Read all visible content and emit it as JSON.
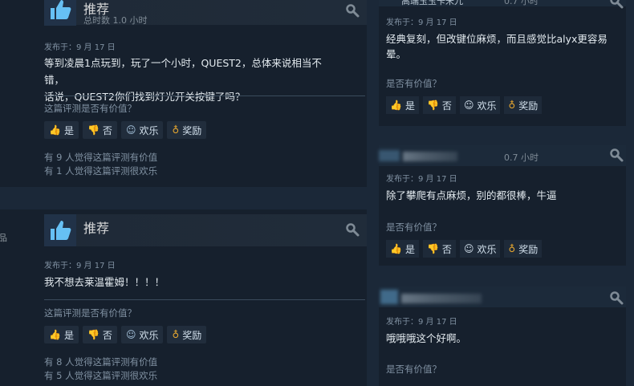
{
  "left_reviews": [
    {
      "recommendation": "推荐",
      "hours": "总时数 1.0 小时",
      "posted": "发布于：9 月 17 日",
      "text_lines": [
        "等到凌晨1点玩到，玩了一个小时，QUEST2，总体来说相当不错，",
        "话说，QUEST2你们找到灯光开关按键了吗？"
      ],
      "helpful_question": "这篇评测是否有价值？",
      "buttons": {
        "yes": "是",
        "no": "否",
        "funny": "欢乐",
        "award": "奖励"
      },
      "votes": [
        "有 9 人觉得这篇评测有价值",
        "有 1 人觉得这篇评测很欢乐"
      ]
    },
    {
      "recommendation": "推荐",
      "posted": "发布于：9 月 17 日",
      "text_lines": [
        "我不想去莱温霍姆！！！！"
      ],
      "helpful_question": "这篇评测是否有价值？",
      "buttons": {
        "yes": "是",
        "no": "否",
        "funny": "欢乐",
        "award": "奖励"
      },
      "votes": [
        "有 8 人觉得这篇评测有价值",
        "有 5 人觉得这篇评测很欢乐"
      ]
    }
  ],
  "right_reviews": [
    {
      "header_fragment": "高端玉玉卡米九",
      "hours": "0.7 小时",
      "posted": "发布于：9 月 17 日",
      "text_lines": [
        "经典复刻，但改键位麻烦，而且感觉比alyx更容易",
        "晕。"
      ],
      "helpful_question": "是否有价值？",
      "buttons": {
        "yes": "是",
        "no": "否",
        "funny": "欢乐",
        "award": "奖励"
      }
    },
    {
      "hours": "0.7 小时",
      "posted": "发布于：9 月 17 日",
      "text_lines": [
        "除了攀爬有点麻烦，别的都很棒，牛逼"
      ],
      "helpful_question": "是否有价值？",
      "buttons": {
        "yes": "是",
        "no": "否",
        "funny": "欢乐",
        "award": "奖励"
      }
    },
    {
      "posted": "发布于：9 月 17 日",
      "text_lines": [
        "哦哦哦这个好啊。"
      ],
      "helpful_question": "是否有价值？"
    }
  ],
  "side_fragment": "品",
  "icons": {
    "thumb_up": "thumb-up-icon",
    "thumb_down": "thumb-down-icon",
    "smile": "smile-icon",
    "award": "award-icon",
    "wrench": "wrench-icon"
  },
  "colors": {
    "bg": "#1b2838",
    "panel": "#16202d",
    "accent": "#66c0f4",
    "award": "#e8a82f"
  }
}
